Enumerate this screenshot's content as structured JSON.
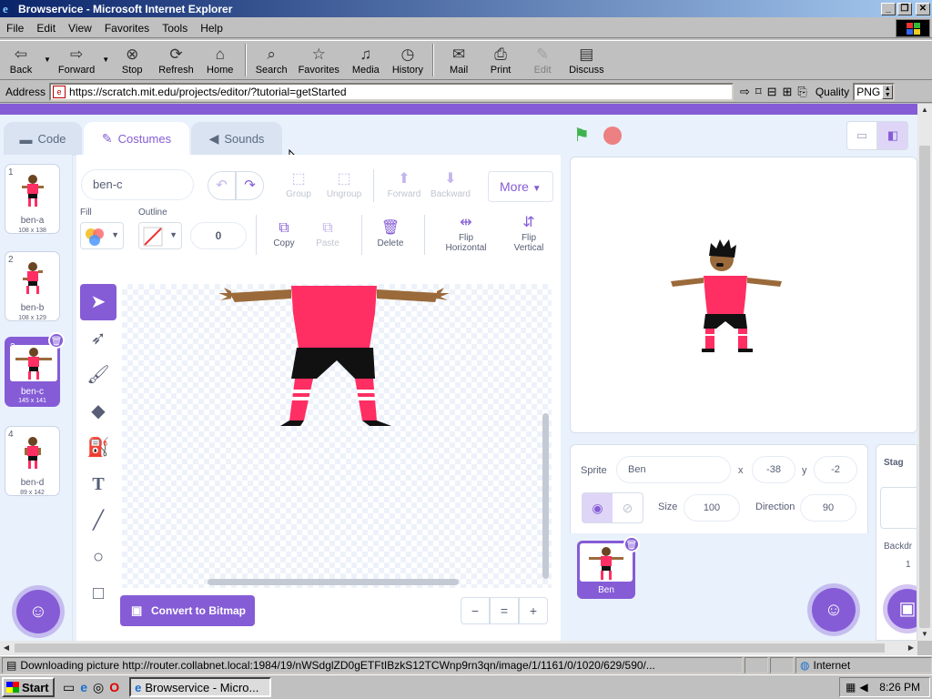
{
  "window": {
    "title": "Browservice - Microsoft Internet Explorer"
  },
  "menu": [
    "File",
    "Edit",
    "View",
    "Favorites",
    "Tools",
    "Help"
  ],
  "toolbar": {
    "back": "Back",
    "forward": "Forward",
    "stop": "Stop",
    "refresh": "Refresh",
    "home": "Home",
    "search": "Search",
    "favorites": "Favorites",
    "media": "Media",
    "history": "History",
    "mail": "Mail",
    "print": "Print",
    "edit": "Edit",
    "discuss": "Discuss"
  },
  "address": {
    "label": "Address",
    "url": "https://scratch.mit.edu/projects/editor/?tutorial=getStarted",
    "quality_label": "Quality",
    "quality_value": "PNG"
  },
  "tabs": {
    "code": "Code",
    "costumes": "Costumes",
    "sounds": "Sounds"
  },
  "costumes": [
    {
      "num": "1",
      "name": "ben-a",
      "size": "108 x 138"
    },
    {
      "num": "2",
      "name": "ben-b",
      "size": "108 x 129"
    },
    {
      "num": "3",
      "name": "ben-c",
      "size": "145 x 141"
    },
    {
      "num": "4",
      "name": "ben-d",
      "size": "89 x 142"
    }
  ],
  "editor": {
    "costume_name": "ben-c",
    "group": "Group",
    "ungroup": "Ungroup",
    "forward": "Forward",
    "backward": "Backward",
    "more": "More",
    "fill": "Fill",
    "outline": "Outline",
    "outline_width": "0",
    "copy": "Copy",
    "paste": "Paste",
    "delete": "Delete",
    "flip_h_1": "Flip",
    "flip_h_2": "Horizontal",
    "flip_v_1": "Flip",
    "flip_v_2": "Vertical",
    "convert": "Convert to Bitmap",
    "zoom_out": "−",
    "zoom_reset": "=",
    "zoom_in": "+"
  },
  "sprite": {
    "label_sprite": "Sprite",
    "name": "Ben",
    "label_x": "x",
    "x": "-38",
    "label_y": "y",
    "y": "-2",
    "label_size": "Size",
    "size": "100",
    "label_direction": "Direction",
    "direction": "90",
    "tile_name": "Ben"
  },
  "stage_pane": {
    "title": "Stag",
    "backdrops": "Backdr",
    "count": "1"
  },
  "status": {
    "message": "Downloading picture http://router.collabnet.local:1984/19/nWSdglZD0gETFtIBzkS12TCWnp9rn3qn/image/1/1161/0/1020/629/590/...",
    "zone": "Internet"
  },
  "taskbar": {
    "start": "Start",
    "task": "Browservice - Micro...",
    "clock": "8:26 PM"
  },
  "colors": {
    "scratch_purple": "#855cd6",
    "jersey": "#ff2e63",
    "skin": "#9b6a3a",
    "shorts": "#111111"
  }
}
